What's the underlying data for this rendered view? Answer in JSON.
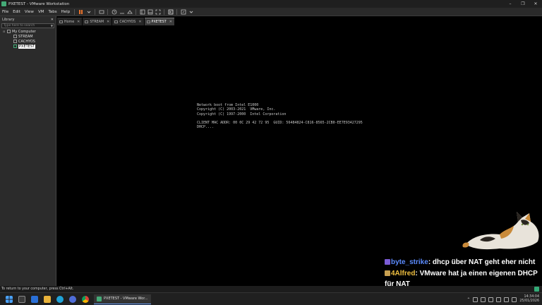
{
  "window": {
    "title": "PXETEST - VMware Workstation",
    "controls": [
      "–",
      "❐",
      "✕"
    ]
  },
  "menu": {
    "items": [
      "File",
      "Edit",
      "View",
      "VM",
      "Tabs",
      "Help"
    ]
  },
  "library": {
    "title": "Library",
    "close": "✕",
    "search_placeholder": "Type here to search",
    "root": "My Computer",
    "vms": [
      "STREAM",
      "CACHYOS",
      "PXETEST"
    ]
  },
  "tabs": [
    {
      "label": "Home",
      "close": "✕"
    },
    {
      "label": "STREAM",
      "close": "✕"
    },
    {
      "label": "CACHYOS",
      "close": "✕"
    },
    {
      "label": "PXETEST",
      "close": "✕"
    }
  ],
  "console": {
    "lines": [
      "Network boot from Intel E1000",
      "Copyright (C) 2003-2021  VMware, Inc.",
      "Copyright (C) 1997-2000  Intel Corporation",
      "",
      "CLIENT MAC ADDR: 00 0C 29 42 72 95  GUID: 56484824-C816-8565-2CB0-EE7E93427295",
      "DHCP...."
    ]
  },
  "chat": {
    "messages": [
      {
        "user": "byte_strike",
        "text": "dhcp über NAT geht eher nicht",
        "color": "#5c8cff"
      },
      {
        "user": "4Alfred",
        "text": "VMware hat ja einen eigenen DHCP für NAT",
        "color": "#f0c040"
      }
    ]
  },
  "statusbar": {
    "text": "To return to your computer, press Ctrl+Alt."
  },
  "taskbar": {
    "active_app": "PXETEST - VMware Wor...",
    "time": "14:34:04",
    "date": "25/01/2026"
  }
}
